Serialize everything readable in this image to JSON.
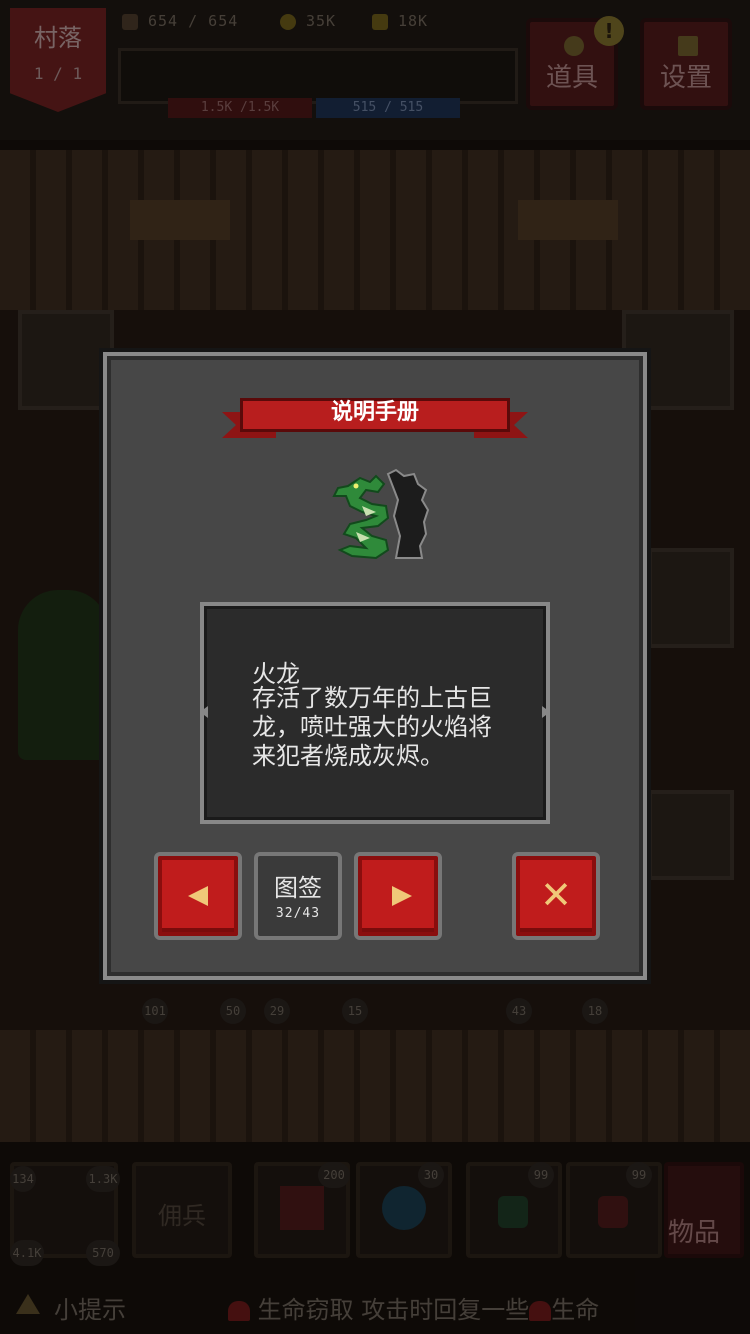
{
  "hud": {
    "banner_title": "村落",
    "banner_sub": "1 / 1",
    "stat_hp": "654 / 654",
    "stat_gold": "35K",
    "stat_crown": "18K",
    "hp_bar": "1.5K /1.5K",
    "mp_bar": "515 / 515",
    "items_button": "道具",
    "settings_button": "设置",
    "alert_mark": "!"
  },
  "scene": {
    "slot_counts": [
      "101",
      "50",
      "29",
      "15",
      "43",
      "18"
    ]
  },
  "bottom": {
    "hero_stats": [
      "134",
      "1.3K",
      "4.1K",
      "570"
    ],
    "mercenary_label": "佣兵",
    "skill_counts": [
      "200",
      "30"
    ],
    "potion_counts": [
      "99",
      "99"
    ],
    "items_label": "物品",
    "hint_label": "小提示",
    "ticker_part1": "生命窃取 攻击时回复一些",
    "ticker_part2": "生命"
  },
  "modal": {
    "title": "说明手册",
    "entry_name": "火龙",
    "entry_description": "存活了数万年的上古巨龙，喷吐强大的火焰将来犯者烧成灰烬。",
    "codex_label": "图签",
    "codex_count": "32/43",
    "prev_icon": "left-triangle-icon",
    "next_icon": "right-triangle-icon",
    "close_icon": "close-x-icon"
  },
  "colors": {
    "accent_red": "#c01c1c",
    "ribbon_red": "#b81e1e",
    "arrow_gold": "#f0c878",
    "panel_gray": "#474747",
    "text_light": "#e6e6e6"
  }
}
